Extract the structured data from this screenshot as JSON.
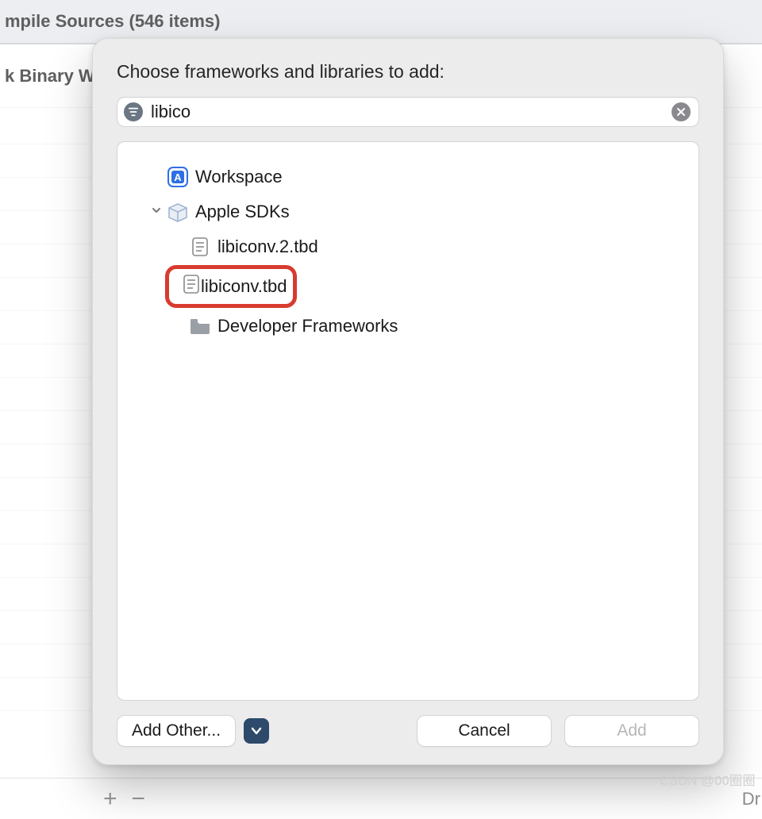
{
  "background": {
    "row1": "mpile Sources (546 items)",
    "row2": "k Binary W",
    "footer_plus": "+",
    "footer_minus": "−",
    "footer_right": "Dr"
  },
  "dialog": {
    "title": "Choose frameworks and libraries to add:",
    "search": {
      "value": "libico"
    },
    "tree": {
      "workspace": "Workspace",
      "apple_sdks": "Apple SDKs",
      "file1": "libiconv.2.tbd",
      "file2": "libiconv.tbd",
      "dev_frameworks": "Developer Frameworks"
    },
    "buttons": {
      "add_other": "Add Other...",
      "cancel": "Cancel",
      "add": "Add"
    }
  },
  "watermark": "CSDN @00圈圈"
}
